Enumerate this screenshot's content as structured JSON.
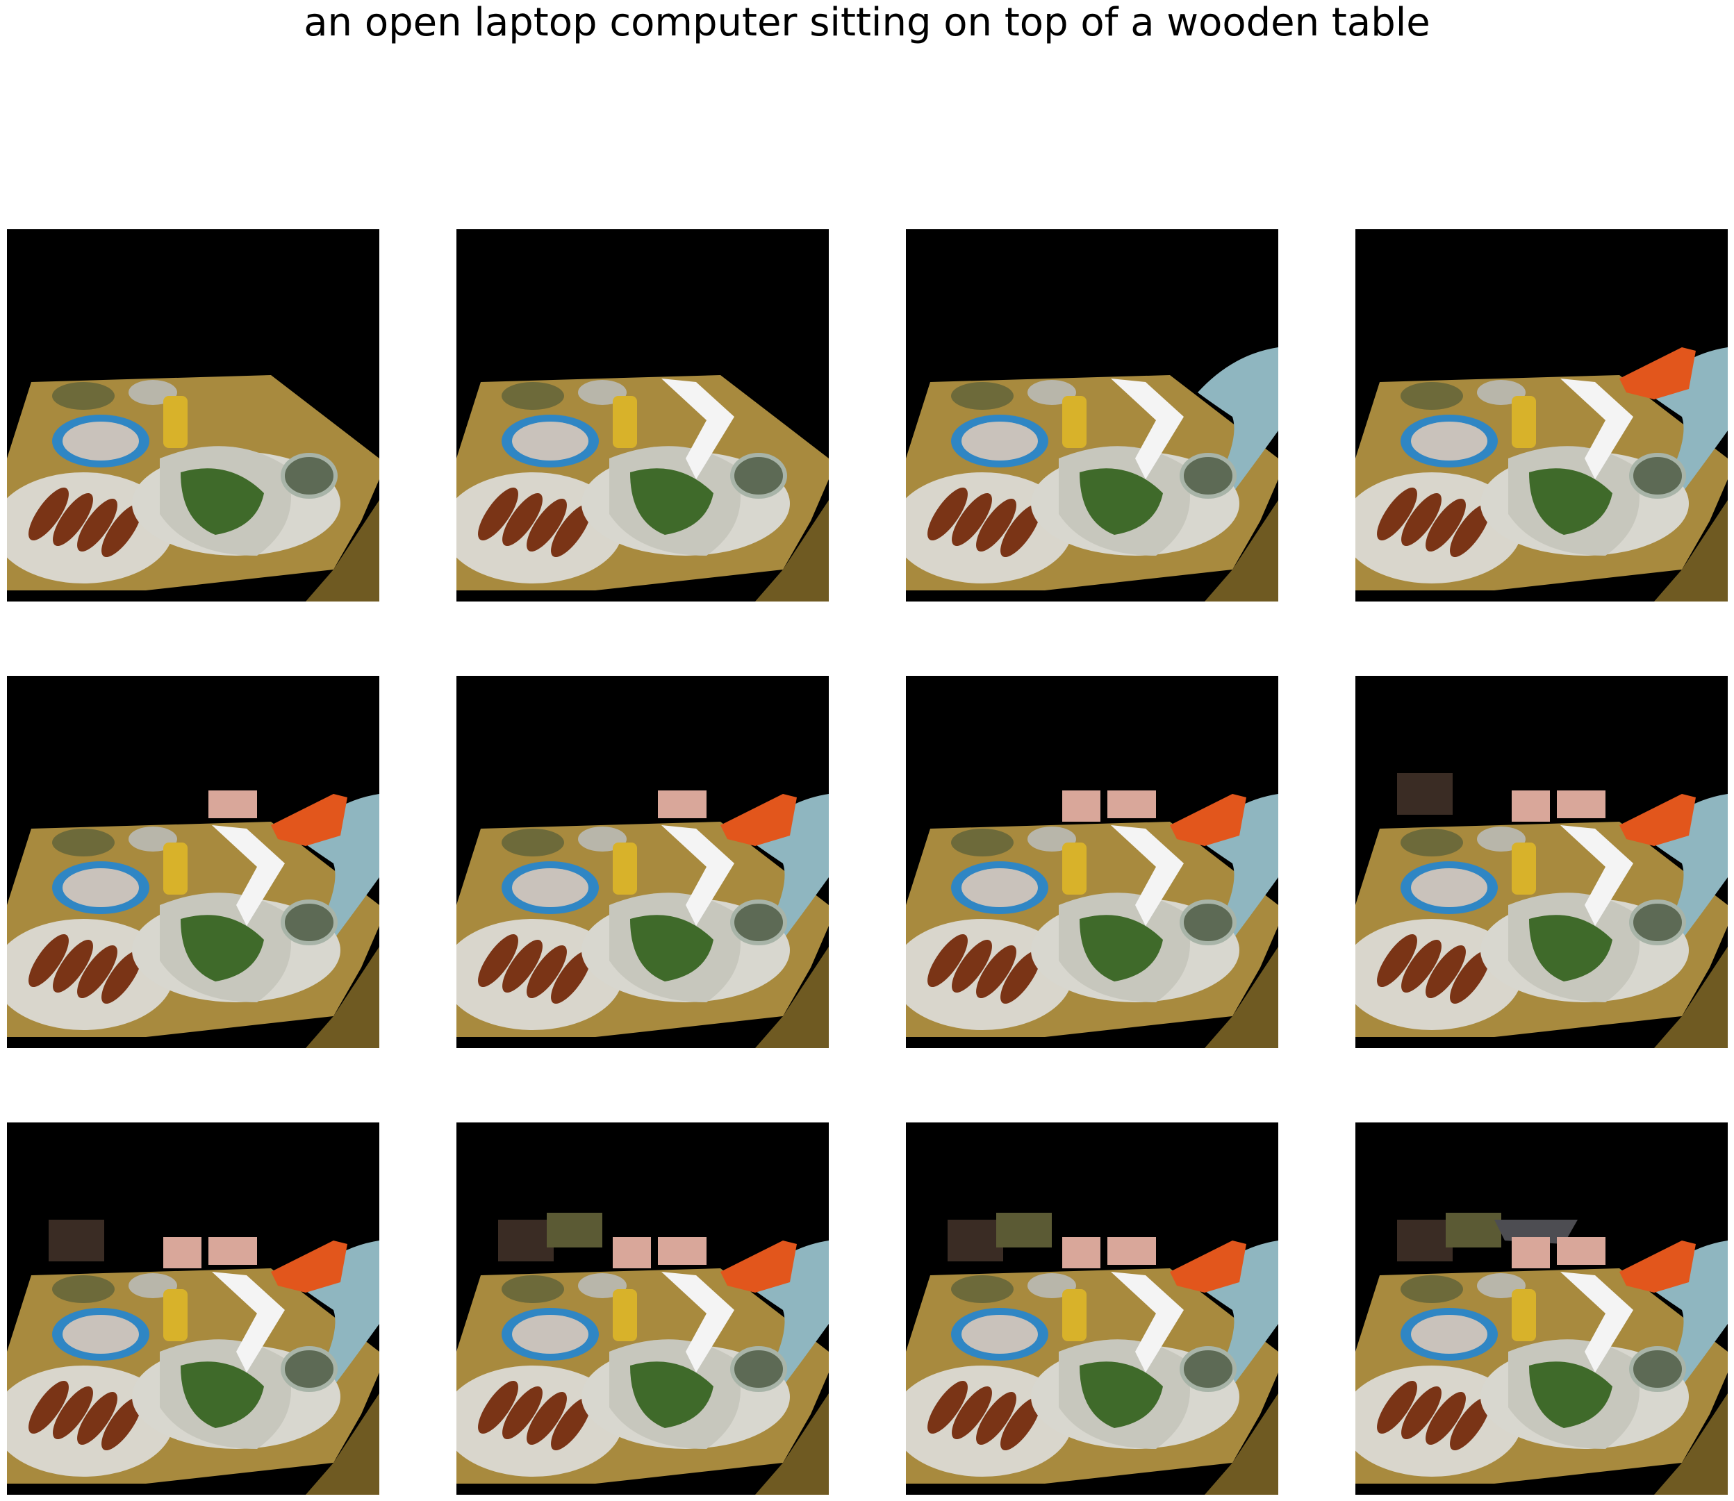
{
  "figure": {
    "title": "an open laptop computer sitting on top of a wooden table",
    "rows": 3,
    "cols": 4,
    "panel_count": 12,
    "background": "#ffffff",
    "panel_background": "#000000"
  },
  "colors": {
    "table_wood": "#a88a3e",
    "table_edge": "#6f5a22",
    "plate_white": "#d9d6cc",
    "blue_plate": "#2f86c4",
    "sausage": "#7a3416",
    "foil": "#c7c7bd",
    "greens": "#3f6a2a",
    "chair_blue": "#8fb6c0",
    "orange_object": "#e2561c",
    "pink_object": "#d9a79a",
    "white_paper": "#f4f4f4",
    "dark_object": "#3a2c24"
  },
  "panels": [
    {
      "chair": false,
      "orange": false,
      "pink": 0,
      "dark": 0
    },
    {
      "chair": false,
      "orange": false,
      "pink": 0,
      "dark": 0
    },
    {
      "chair": true,
      "orange": false,
      "pink": 0,
      "dark": 0
    },
    {
      "chair": true,
      "orange": true,
      "pink": 0,
      "dark": 0
    },
    {
      "chair": true,
      "orange": true,
      "pink": 1,
      "dark": 0
    },
    {
      "chair": true,
      "orange": true,
      "pink": 1,
      "dark": 0
    },
    {
      "chair": true,
      "orange": true,
      "pink": 2,
      "dark": 0
    },
    {
      "chair": true,
      "orange": true,
      "pink": 2,
      "dark": 1
    },
    {
      "chair": true,
      "orange": true,
      "pink": 2,
      "dark": 1
    },
    {
      "chair": true,
      "orange": true,
      "pink": 2,
      "dark": 2
    },
    {
      "chair": true,
      "orange": true,
      "pink": 2,
      "dark": 2
    },
    {
      "chair": true,
      "orange": true,
      "pink": 2,
      "dark": 3
    }
  ]
}
